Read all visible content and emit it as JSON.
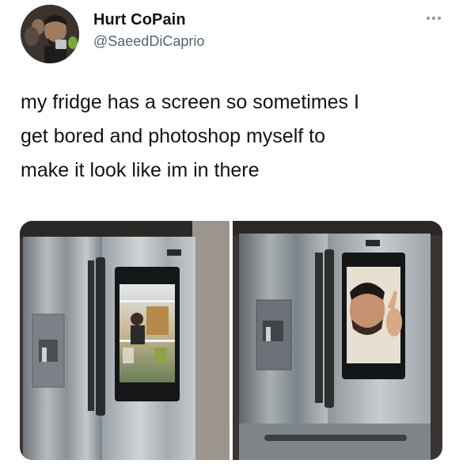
{
  "tweet": {
    "display_name": "Hurt CoPain",
    "handle": "@SaeedDiCaprio",
    "text": "my fridge has a screen so sometimes I\nget bored and photoshop myself to\nmake it look like im in there"
  },
  "icons": {
    "more": "more-options-icon"
  },
  "media": {
    "images": [
      {
        "name": "fridge-photo-inside-reaching"
      },
      {
        "name": "fridge-photo-face-waving"
      }
    ]
  },
  "colors": {
    "text": "#0f1419",
    "secondary": "#536471",
    "steel": "#9aa1a6"
  }
}
